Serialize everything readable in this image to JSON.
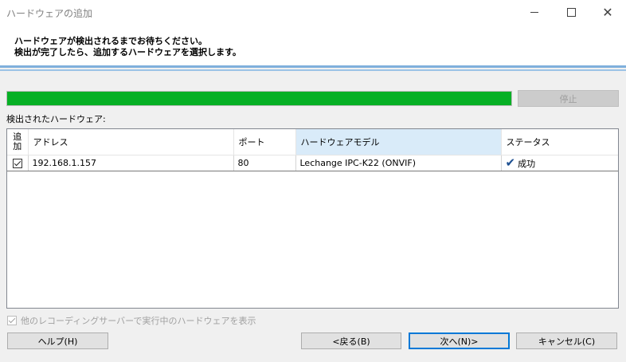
{
  "window": {
    "title": "ハードウェアの追加",
    "controls": {
      "minimize_icon": "minimize-icon",
      "maximize_icon": "maximize-icon",
      "close_icon": "close-icon",
      "close_glyph": "✕"
    }
  },
  "header": {
    "line1": "ハードウェアが検出されるまでお待ちください。",
    "line2": "検出が完了したら、追加するハードウェアを選択します。"
  },
  "progress": {
    "value_percent": 100,
    "color": "#06b025"
  },
  "stop_button": {
    "label": "停止",
    "enabled": false
  },
  "detected_label": "検出されたハードウェア:",
  "table": {
    "columns": [
      "追加",
      "アドレス",
      "ポート",
      "ハードウェアモデル",
      "ステータス"
    ],
    "sorted_column": "ハードウェアモデル",
    "rows": [
      {
        "add": true,
        "address": "192.168.1.157",
        "port": "80",
        "model": "Lechange IPC-K22 (ONVIF)",
        "status": "成功",
        "status_icon": "checkmark-icon",
        "status_glyph": "✔"
      }
    ]
  },
  "show_other_servers": {
    "label": "他のレコーディングサーバーで実行中のハードウェアを表示",
    "checked": true,
    "enabled": false
  },
  "footer": {
    "help": "ヘルプ(H)",
    "back": "<戻る(B)",
    "next": "次へ(N)>",
    "cancel": "キャンセル(C)"
  },
  "colors": {
    "accent": "#0078d7",
    "header_rule": "#7fb0dc",
    "sorted_header": "#d9ebf9"
  }
}
